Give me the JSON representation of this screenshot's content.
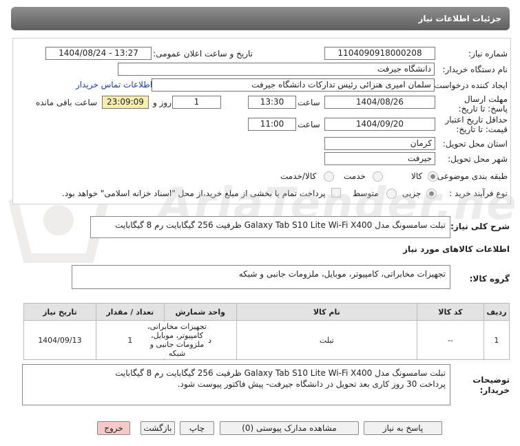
{
  "header": {
    "title": "جزئیات اطلاعات نیاز"
  },
  "form": {
    "need_number_label": "شماره نیاز:",
    "need_number": "1104090918000208",
    "announce_label": "تاریخ و ساعت اعلان عمومی:",
    "announce_value": "1404/08/24 - 13:27",
    "buyer_org_label": "نام دستگاه خریدار:",
    "buyer_org": "دانشگاه جیرفت",
    "creator_label": "ایجاد کننده درخواست:",
    "creator": "سلمان امیری هنزائی رئیس تدارکات دانشگاه جیرفت",
    "contact_link": "اطلاعات تماس خریدار",
    "reply_deadline_label": "مهلت ارسال پاسخ: تا تاریخ:",
    "reply_date": "1404/08/26",
    "time_label": "ساعت",
    "reply_time": "13:30",
    "days_value": "1",
    "days_and_label": "روز و",
    "remaining_time": "23:09:09",
    "remaining_label": "ساعت باقی مانده",
    "validity_label": "حداقل تاریخ اعتبار قیمت: تا تاریخ:",
    "validity_date": "1404/09/20",
    "validity_time": "11:00",
    "province_label": "استان محل تحویل:",
    "province": "کرمان",
    "city_label": "شهر محل تحویل:",
    "city": "جیرفت",
    "category_label": "طبقه بندی موضوعی:",
    "category_options": [
      "کالا",
      "خدمت",
      "کالا/خدمت"
    ],
    "process_label": "نوع فرآیند خرید :",
    "process_options": [
      "جزیی",
      "متوسط"
    ],
    "treasury_note": "پرداخت تمام یا بخشی از مبلغ خرید،از محل \"اسناد خزانه اسلامی\" خواهد بود."
  },
  "summary": {
    "label": "شرح کلی نیاز:",
    "text": "تبلت سامسونگ مدل Galaxy Tab S10 Lite Wi-Fi X400 ظرفیت 256 گیگابایت رم 8 گیگابایت"
  },
  "goods_info_title": "اطلاعات کالاهای مورد نیاز",
  "goods_group": {
    "label": "گروه کالا:",
    "value": "تجهیزات مخابراتی، کامپیوتر، موبایل، ملزومات جانبی و شبکه"
  },
  "table": {
    "headers": [
      "ردیف",
      "کد کالا",
      "نام کالا",
      "واحد شمارش",
      "تعداد / مقدار",
      "تاریخ نیاز"
    ],
    "rows": [
      [
        "1",
        "--",
        "تبلت",
        "دستگاه",
        "1",
        "1404/09/13"
      ]
    ],
    "group_cell": "تجهیزات مخابراتی، کامپیوتر، موبایل، ملزومات جانبی و شبکه"
  },
  "buyer_notes": {
    "label": "توضیحات خریدار:",
    "line1": "تبلت سامسونگ مدل Galaxy Tab S10 Lite Wi-Fi X400 ظرفیت 256 گیگابایت رم 8 گیگابایت",
    "line2": "پرداخت 30 روز کاری بعد تحویل در دانشگاه جیرفت- پیش فاکتور پیوست شود."
  },
  "buttons": {
    "reply": "پاسخ به نیاز",
    "attachments": "مشاهده مدارک پیوستی (0)",
    "print": "چاپ",
    "back": "بازگشت",
    "exit": "خروج"
  },
  "watermark": "AriaTender.net",
  "colors": {
    "header_bg": "#6f6f6f",
    "remaining_bg": "#f6eeb1",
    "link": "#1a3eaa",
    "exit_bg": "#f6c9c9"
  }
}
